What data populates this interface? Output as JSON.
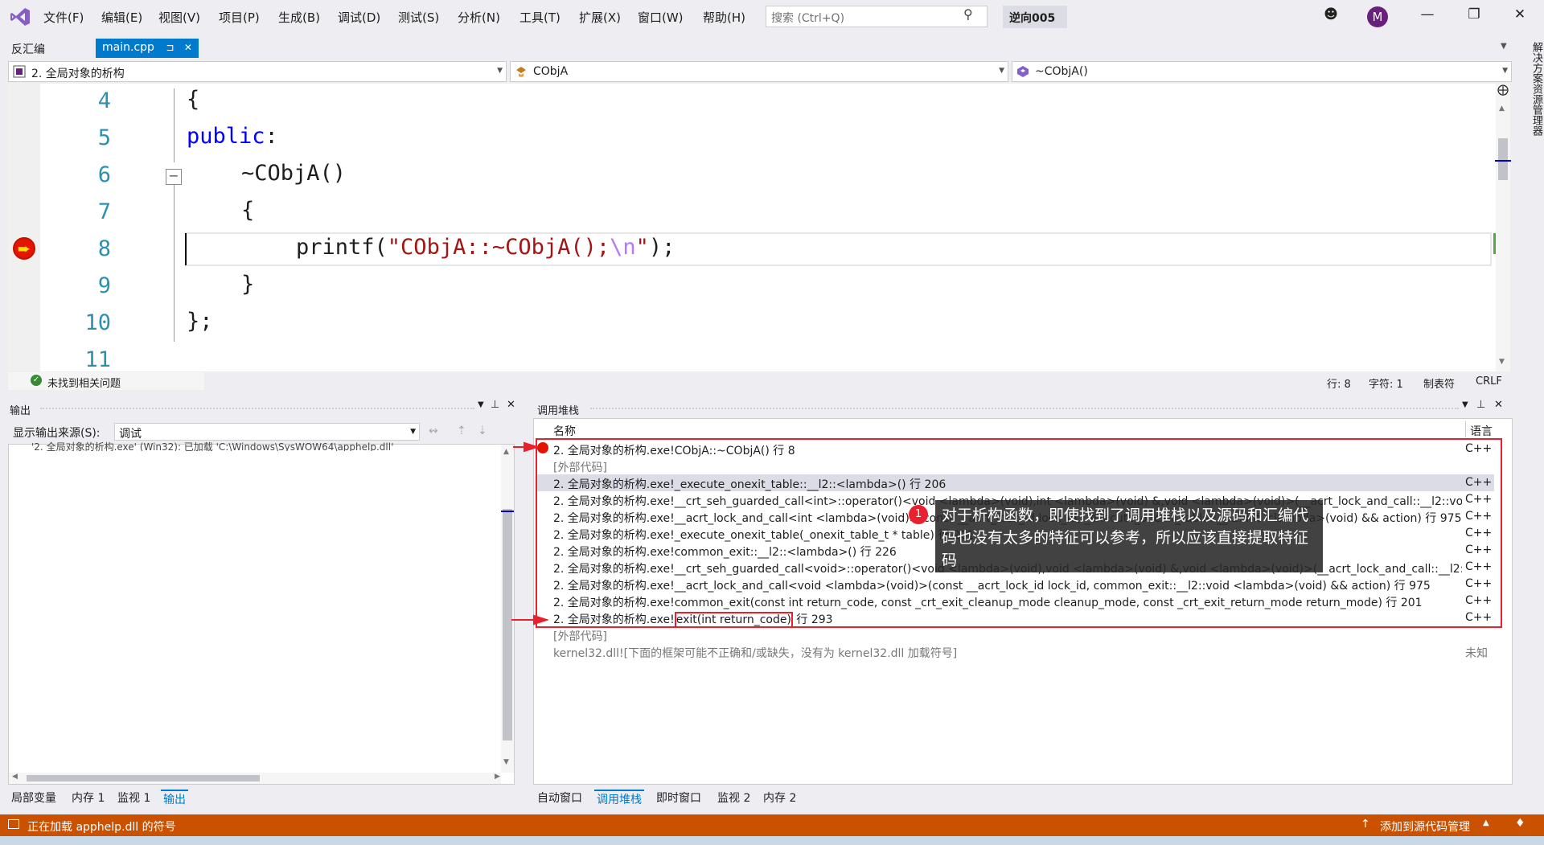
{
  "menu": [
    "文件(F)",
    "编辑(E)",
    "视图(V)",
    "项目(P)",
    "生成(B)",
    "调试(D)",
    "测试(S)",
    "分析(N)",
    "工具(T)",
    "扩展(X)",
    "窗口(W)",
    "帮助(H)"
  ],
  "search": {
    "placeholder": "搜索 (Ctrl+Q)"
  },
  "project_name": "逆向005",
  "avatar_letter": "M",
  "tabs": {
    "disasm": "反汇编",
    "main": "main.cpp",
    "pin": "⊐",
    "close": "✕"
  },
  "nav": {
    "project": "2. 全局对象的析构",
    "class": "CObjA",
    "member": "~CObjA()"
  },
  "code": {
    "line_numbers": [
      "4",
      "5",
      "6",
      "7",
      "8",
      "9",
      "10",
      "11"
    ],
    "l4": "{",
    "l5_kw": "public",
    "l5_rest": ":",
    "l6": "~CObjA()",
    "l7": "{",
    "l8_fn": "printf(",
    "l8_str": "\"CObjA::~CObjA();",
    "l8_esc": "\\n",
    "l8_str_end": "\"",
    "l8_end": ");",
    "l9": "}",
    "l10": "};"
  },
  "editor_status": {
    "issues": "未找到相关问题",
    "line": "行: 8",
    "char": "字符: 1",
    "tabs": "制表符",
    "eol": "CRLF"
  },
  "output": {
    "title": "输出",
    "source_label": "显示输出来源(S):",
    "source_value": "调试",
    "first_line": "'2. 全局对象的析构.exe' (Win32): 已加载 'C:\\Windows\\SysWOW64\\apphelp.dll'"
  },
  "callstack": {
    "title": "调用堆栈",
    "col_name": "名称",
    "col_lang": "语言",
    "rows": [
      {
        "name": "2. 全局对象的析构.exe!CObjA::~CObjA() 行 8",
        "lang": "C++"
      },
      {
        "name": "[外部代码]",
        "lang": ""
      },
      {
        "name": "2. 全局对象的析构.exe!_execute_onexit_table::__l2::<lambda>() 行 206",
        "lang": "C++"
      },
      {
        "name": "2. 全局对象的析构.exe!__crt_seh_guarded_call<int>::operator()<void <lambda>(void),int <lambda>(void) &,void <lambda>(void)>(__acrt_lock_and_call::__l2::void <lamb...",
        "lang": "C++"
      },
      {
        "name": "2. 全局对象的析构.exe!__acrt_lock_and_call<int <lambda>(void)>(const __acrt_lock_id lock_id, _execute_onexit_table::__l2::int <lambda>(void) && action) 行 975",
        "lang": "C++"
      },
      {
        "name": "2. 全局对象的析构.exe!_execute_onexit_table(_onexit_table_t * table) 行 201",
        "lang": "C++"
      },
      {
        "name": "2. 全局对象的析构.exe!common_exit::__l2::<lambda>() 行 226",
        "lang": "C++"
      },
      {
        "name": "2. 全局对象的析构.exe!__crt_seh_guarded_call<void>::operator()<void <lambda>(void),void <lambda>(void) &,void <lambda>(void)>(__acrt_lock_and_call::__l2::void <l...",
        "lang": "C++"
      },
      {
        "name": "2. 全局对象的析构.exe!__acrt_lock_and_call<void <lambda>(void)>(const __acrt_lock_id lock_id, common_exit::__l2::void <lambda>(void) && action) 行 975",
        "lang": "C++"
      },
      {
        "name": "2. 全局对象的析构.exe!common_exit(const int return_code, const _crt_exit_cleanup_mode cleanup_mode, const _crt_exit_return_mode return_mode) 行 201",
        "lang": "C++"
      },
      {
        "name_prefix": "2. 全局对象的析构.exe!",
        "name_highlight": "exit(int return_code)",
        "name_suffix": " 行 293",
        "lang": "C++"
      },
      {
        "name": "[外部代码]",
        "lang": ""
      },
      {
        "name": "kernel32.dll![下面的框架可能不正确和/或缺失，没有为 kernel32.dll 加载符号]",
        "lang": "未知"
      }
    ]
  },
  "callout": {
    "badge": "1",
    "text": "对于析构函数，即使找到了调用堆栈以及源码和汇编代码也没有太多的特征可以参考，所以应该直接提取特征码"
  },
  "bottom_tabs_left": [
    "局部变量",
    "内存 1",
    "监视 1",
    "输出"
  ],
  "bottom_tabs_right": [
    "自动窗口",
    "调用堆栈",
    "即时窗口",
    "监视 2",
    "内存 2"
  ],
  "side_tab": "解决方案资源管理器",
  "status": {
    "loading": "正在加载 apphelp.dll 的符号",
    "source_control": "添加到源代码管理"
  },
  "colors": {
    "accent": "#007acc",
    "status_bar": "#ca5100",
    "highlight_box": "#e8212e",
    "breakpoint": "#e51400"
  }
}
